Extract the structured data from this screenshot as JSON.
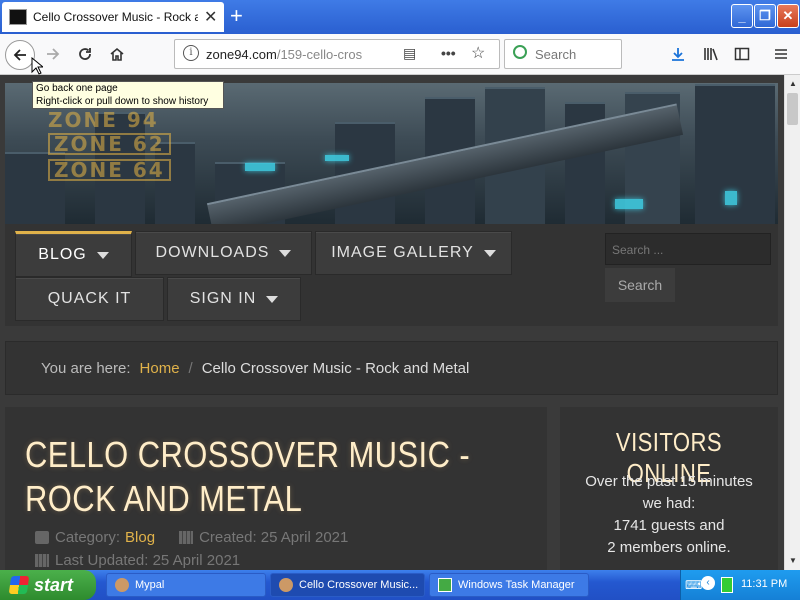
{
  "browser": {
    "tab_title": "Cello Crossover Music - Rock and M",
    "tab_close": "✕",
    "new_tab": "+",
    "window_controls": {
      "minimize": "_",
      "maximize": "❐",
      "close": "✕"
    },
    "url_host": "zone94.com",
    "url_path": "/159-cello-cros",
    "search_placeholder": "Search",
    "tooltip_line1": "Go back one page",
    "tooltip_line2": "Right-click or pull down to show history"
  },
  "page": {
    "menu": {
      "blog": "BLOG",
      "downloads": "DOWNLOADS",
      "image_gallery": "IMAGE GALLERY",
      "quack_it": "QUACK IT",
      "sign_in": "SIGN IN",
      "search_placeholder": "Search ...",
      "search_button": "Search"
    },
    "breadcrumb": {
      "prefix": "You are here:",
      "home": "Home",
      "separator": "/",
      "current": "Cello Crossover Music - Rock and Metal"
    },
    "article": {
      "title": "CELLO CROSSOVER MUSIC - ROCK AND METAL",
      "category_label": "Category:",
      "category_value": "Blog",
      "created": "Created: 25 April 2021",
      "updated": "Last Updated: 25 April 2021"
    },
    "sidebar": {
      "title": "VISITORS ONLINE",
      "line1": "Over the past 15 minutes",
      "line2": "we had:",
      "line3": "1741 guests and",
      "line4": "2 members online."
    },
    "banner_logo": {
      "line1": "ZONE 94",
      "line2": "ZONE 62",
      "line3": "ZONE 64"
    }
  },
  "taskbar": {
    "start": "start",
    "tasks": [
      {
        "label": "Mypal"
      },
      {
        "label": "Cello Crossover Music..."
      },
      {
        "label": "Windows Task Manager"
      }
    ],
    "clock": "11:31 PM"
  },
  "colors": {
    "accent": "#e0b24a",
    "title": "#ffedc8",
    "background": "#3a3a3a"
  }
}
